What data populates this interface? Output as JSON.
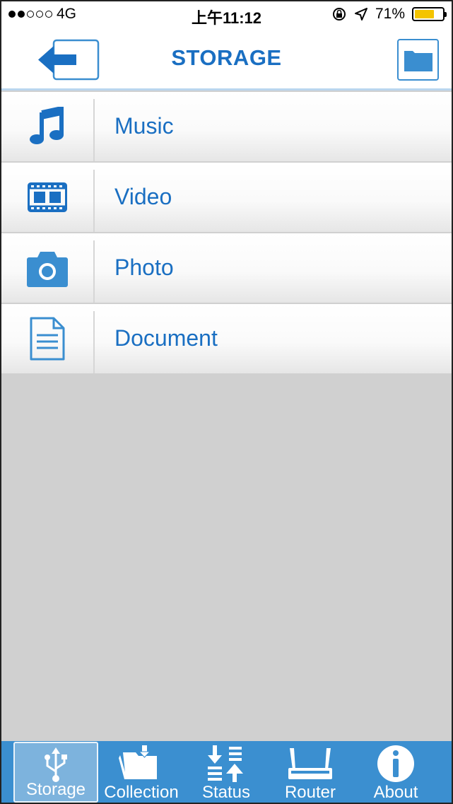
{
  "status_bar": {
    "carrier": "4G",
    "signal_dots_filled": 2,
    "signal_dots_total": 5,
    "time": "上午11:12",
    "battery": "71%",
    "battery_level": 0.71
  },
  "header": {
    "title": "STORAGE",
    "back_icon": "back-arrow-icon",
    "folder_icon": "folder-icon"
  },
  "list": {
    "items": [
      {
        "label": "Music",
        "icon": "music-note-icon"
      },
      {
        "label": "Video",
        "icon": "film-icon"
      },
      {
        "label": "Photo",
        "icon": "camera-icon"
      },
      {
        "label": "Document",
        "icon": "document-icon"
      }
    ]
  },
  "tabbar": {
    "tabs": [
      {
        "label": "Storage",
        "icon": "usb-icon",
        "active": true
      },
      {
        "label": "Collection",
        "icon": "folder-download-icon",
        "active": false
      },
      {
        "label": "Status",
        "icon": "transfer-status-icon",
        "active": false
      },
      {
        "label": "Router",
        "icon": "router-icon",
        "active": false
      },
      {
        "label": "About",
        "icon": "info-icon",
        "active": false
      }
    ]
  },
  "colors": {
    "accent": "#1a6fc2",
    "tabbar": "#3b8fd0",
    "active_tab": "#7db3dd",
    "background": "#d0d0d0"
  }
}
